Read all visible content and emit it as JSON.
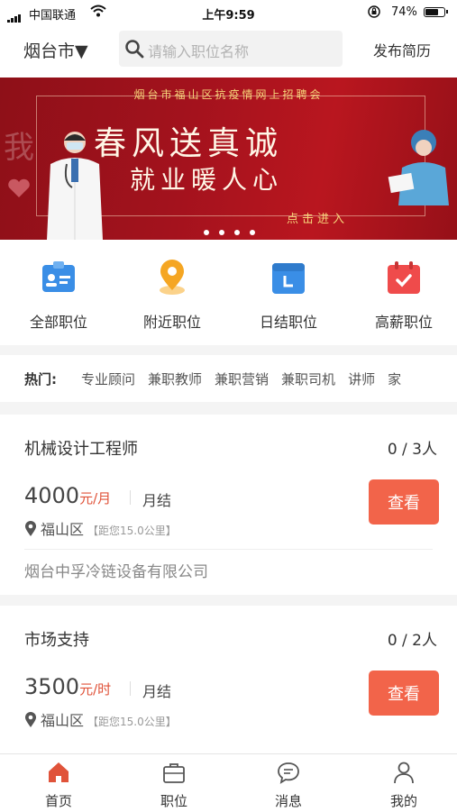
{
  "status_bar": {
    "carrier": "中国联通",
    "time": "上午9:59",
    "battery_percent": "74%",
    "battery_level": 0.74
  },
  "header": {
    "city": "烟台市▼",
    "search_placeholder": "请输入职位名称",
    "post_resume": "发布简历"
  },
  "banner": {
    "top_text": "烟台市福山区抗疫情网上招聘会",
    "slogan_line1": "春风送真诚",
    "slogan_line2": "就业暖人心",
    "enter_text": "点击进入",
    "deco_char": "我",
    "slides": 4,
    "colors": {
      "background": "#a3121d",
      "gold": "#f6d57a"
    }
  },
  "quick_nav": [
    {
      "label": "全部职位",
      "icon": "id-card-icon",
      "color": "#3a8ee6"
    },
    {
      "label": "附近职位",
      "icon": "location-pin-icon",
      "color": "#f5a623"
    },
    {
      "label": "日结职位",
      "icon": "calendar-day-icon",
      "color": "#3a8ee6"
    },
    {
      "label": "高薪职位",
      "icon": "calendar-check-icon",
      "color": "#ef4b4b"
    }
  ],
  "hot": {
    "label": "热门:",
    "tags": [
      "专业顾问",
      "兼职教师",
      "兼职营销",
      "兼职司机",
      "讲师",
      "家"
    ]
  },
  "jobs": [
    {
      "title": "机械设计工程师",
      "count": "0 / 3人",
      "salary": "4000",
      "salary_unit": "元/月",
      "settlement": "月结",
      "district": "福山区",
      "distance": "【距您15.0公里】",
      "company": "烟台中孚冷链设备有限公司",
      "view_label": "查看"
    },
    {
      "title": "市场支持",
      "count": "0 / 2人",
      "salary": "3500",
      "salary_unit": "元/时",
      "settlement": "月结",
      "district": "福山区",
      "distance": "【距您15.0公里】",
      "view_label": "查看"
    }
  ],
  "tab_bar": [
    {
      "label": "首页",
      "icon": "home-icon",
      "active": true
    },
    {
      "label": "职位",
      "icon": "briefcase-icon",
      "active": false
    },
    {
      "label": "消息",
      "icon": "message-icon",
      "active": false
    },
    {
      "label": "我的",
      "icon": "user-icon",
      "active": false
    }
  ],
  "colors": {
    "accent": "#f2644a",
    "active_tab": "#e0533a",
    "salary_unit": "#e0533a"
  }
}
